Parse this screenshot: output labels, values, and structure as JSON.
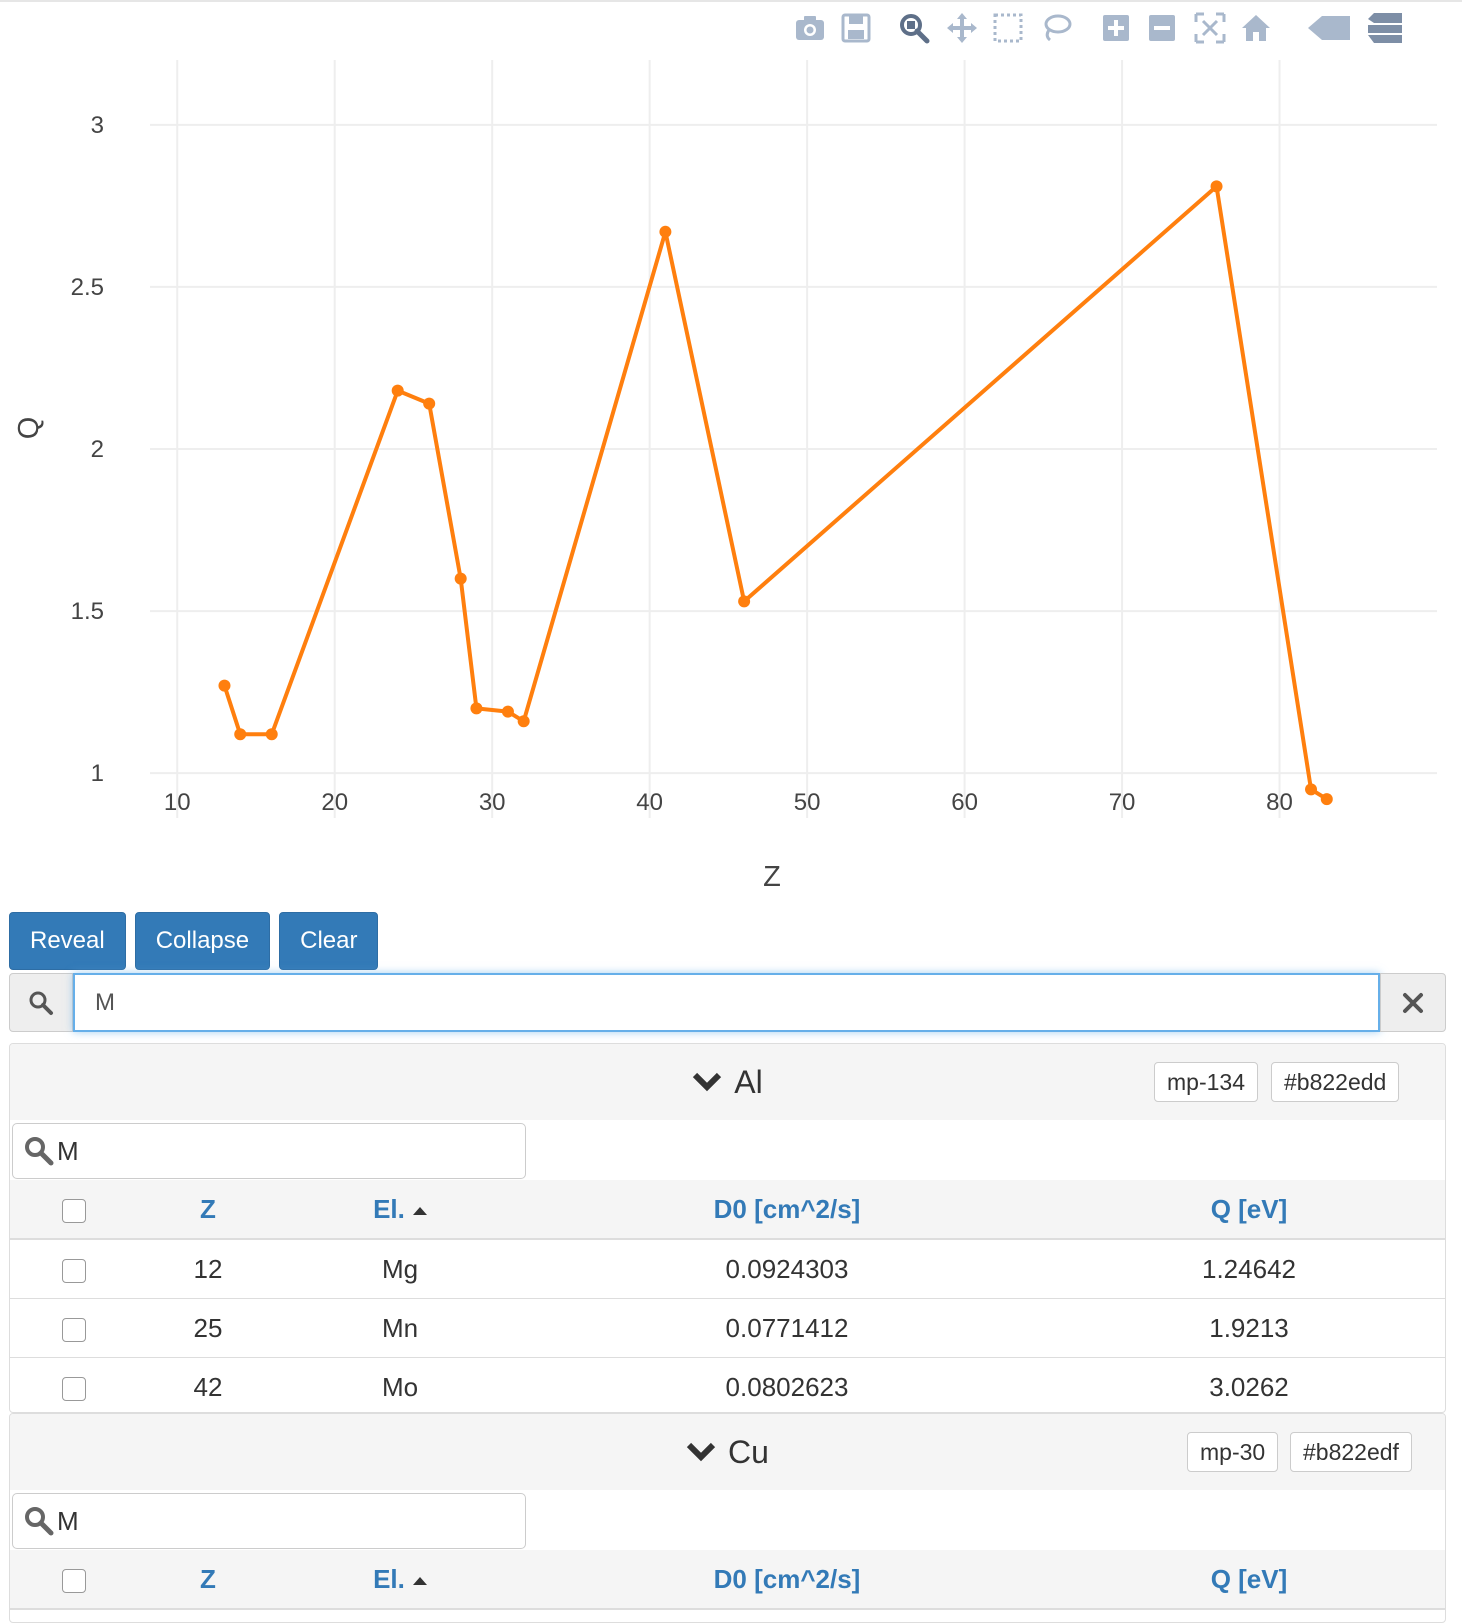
{
  "modebar": {
    "icons": [
      "camera-icon",
      "save-icon",
      "zoom-icon",
      "pan-icon",
      "box-select-icon",
      "lasso-icon",
      "zoom-in-icon",
      "zoom-out-icon",
      "autoscale-icon",
      "home-icon",
      "spike-lines-icon",
      "hover-compare-icon"
    ]
  },
  "chart_data": {
    "type": "line",
    "xlabel": "Z",
    "ylabel": "Q",
    "xlim": [
      7,
      90
    ],
    "ylim": [
      0.8,
      3.2
    ],
    "xticks": [
      "10",
      "20",
      "30",
      "40",
      "50",
      "60",
      "70",
      "80"
    ],
    "yticks": [
      "1",
      "1.5",
      "2",
      "2.5",
      "3"
    ],
    "grid": true,
    "color": "#ff7f0e",
    "series": [
      {
        "x": [
          13,
          14,
          16,
          24,
          26,
          28,
          29,
          31,
          32,
          41,
          46,
          76,
          82,
          83
        ],
        "y": [
          1.27,
          1.12,
          1.12,
          2.18,
          2.14,
          1.6,
          1.2,
          1.19,
          1.16,
          2.67,
          1.53,
          2.81,
          0.95,
          0.92
        ]
      }
    ]
  },
  "buttons": {
    "reveal": "Reveal",
    "collapse": "Collapse",
    "clear": "Clear"
  },
  "search": {
    "value": "M"
  },
  "panels": [
    {
      "title": "Al",
      "mpid": "mp-134",
      "hash": "#b822edd",
      "filter": "M",
      "columns": [
        "Z",
        "El.",
        "D0 [cm^2/s]",
        "Q [eV]"
      ],
      "rows": [
        {
          "z": "12",
          "el": "Mg",
          "d0": "0.0924303",
          "q": "1.24642"
        },
        {
          "z": "25",
          "el": "Mn",
          "d0": "0.0771412",
          "q": "1.9213"
        },
        {
          "z": "42",
          "el": "Mo",
          "d0": "0.0802623",
          "q": "3.0262"
        }
      ]
    },
    {
      "title": "Cu",
      "mpid": "mp-30",
      "hash": "#b822edf",
      "filter": "M",
      "columns": [
        "Z",
        "El.",
        "D0 [cm^2/s]",
        "Q [eV]"
      ]
    }
  ]
}
